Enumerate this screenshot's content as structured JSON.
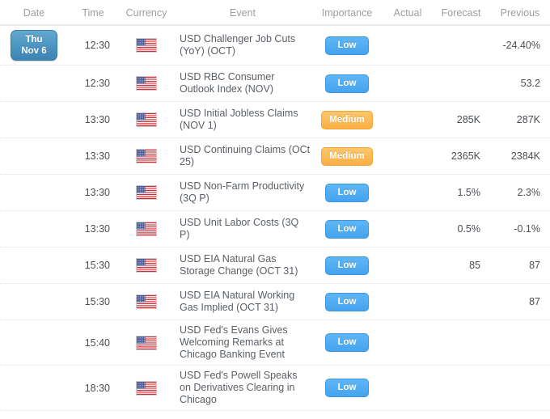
{
  "table": {
    "columns": [
      {
        "key": "date",
        "label": "Date"
      },
      {
        "key": "time",
        "label": "Time"
      },
      {
        "key": "currency",
        "label": "Currency"
      },
      {
        "key": "event",
        "label": "Event"
      },
      {
        "key": "importance",
        "label": "Importance"
      },
      {
        "key": "actual",
        "label": "Actual"
      },
      {
        "key": "forecast",
        "label": "Forecast"
      },
      {
        "key": "previous",
        "label": "Previous"
      }
    ],
    "colors": {
      "low_badge": "#45a3ee",
      "medium_badge": "#f9ae45",
      "date_badge": "#4f97c4",
      "header_text": "#9a9ea3",
      "body_text": "#5a6066",
      "divider": "#dfe1e4"
    },
    "rows": [
      {
        "date_weekday": "Thu",
        "date_monthday": "Nov 6",
        "show_date": true,
        "time": "12:30",
        "currency_flag": "us-flag-icon",
        "event": "USD Challenger Job Cuts (YoY) (OCT)",
        "importance": "Low",
        "actual": "",
        "forecast": "",
        "previous": "-24.40%"
      },
      {
        "date_weekday": "",
        "date_monthday": "",
        "show_date": false,
        "time": "12:30",
        "currency_flag": "us-flag-icon",
        "event": "USD RBC Consumer Outlook Index (NOV)",
        "importance": "Low",
        "actual": "",
        "forecast": "",
        "previous": "53.2"
      },
      {
        "date_weekday": "",
        "date_monthday": "",
        "show_date": false,
        "time": "13:30",
        "currency_flag": "us-flag-icon",
        "event": "USD Initial Jobless Claims (NOV 1)",
        "importance": "Medium",
        "actual": "",
        "forecast": "285K",
        "previous": "287K"
      },
      {
        "date_weekday": "",
        "date_monthday": "",
        "show_date": false,
        "time": "13:30",
        "currency_flag": "us-flag-icon",
        "event": "USD Continuing Claims (OCt 25)",
        "importance": "Medium",
        "actual": "",
        "forecast": "2365K",
        "previous": "2384K"
      },
      {
        "date_weekday": "",
        "date_monthday": "",
        "show_date": false,
        "time": "13:30",
        "currency_flag": "us-flag-icon",
        "event": "USD Non-Farm Productivity (3Q P)",
        "importance": "Low",
        "actual": "",
        "forecast": "1.5%",
        "previous": "2.3%"
      },
      {
        "date_weekday": "",
        "date_monthday": "",
        "show_date": false,
        "time": "13:30",
        "currency_flag": "us-flag-icon",
        "event": "USD Unit Labor Costs (3Q P)",
        "importance": "Low",
        "actual": "",
        "forecast": "0.5%",
        "previous": "-0.1%"
      },
      {
        "date_weekday": "",
        "date_monthday": "",
        "show_date": false,
        "time": "15:30",
        "currency_flag": "us-flag-icon",
        "event": "USD EIA Natural Gas Storage Change (OCT 31)",
        "importance": "Low",
        "actual": "",
        "forecast": "85",
        "previous": "87"
      },
      {
        "date_weekday": "",
        "date_monthday": "",
        "show_date": false,
        "time": "15:30",
        "currency_flag": "us-flag-icon",
        "event": "USD EIA Natural Working Gas Implied (OCT 31)",
        "importance": "Low",
        "actual": "",
        "forecast": "",
        "previous": "87"
      },
      {
        "date_weekday": "",
        "date_monthday": "",
        "show_date": false,
        "time": "15:40",
        "currency_flag": "us-flag-icon",
        "event": "USD Fed's Evans Gives Welcoming Remarks at Chicago Banking Event",
        "importance": "Low",
        "actual": "",
        "forecast": "",
        "previous": ""
      },
      {
        "date_weekday": "",
        "date_monthday": "",
        "show_date": false,
        "time": "18:30",
        "currency_flag": "us-flag-icon",
        "event": "USD Fed's Powell Speaks on Derivatives Clearing in Chicago",
        "importance": "Low",
        "actual": "",
        "forecast": "",
        "previous": ""
      }
    ]
  }
}
